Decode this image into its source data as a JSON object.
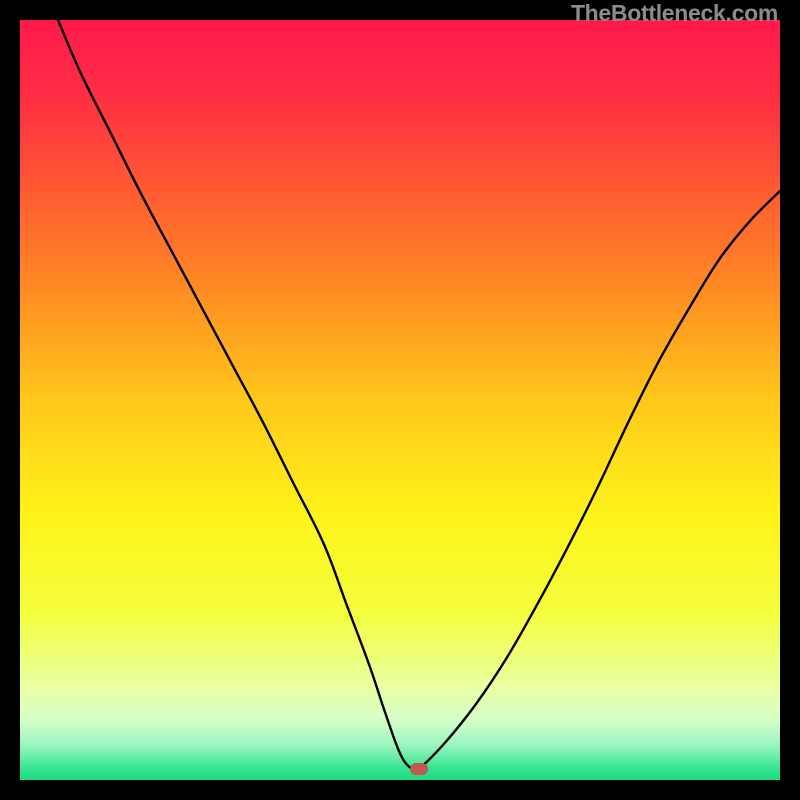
{
  "watermark": "TheBottleneck.com",
  "chart_data": {
    "type": "line",
    "title": "",
    "xlabel": "",
    "ylabel": "",
    "xlim": [
      0,
      100
    ],
    "ylim": [
      0,
      100
    ],
    "grid": false,
    "background_gradient": {
      "stops": [
        {
          "pos": 0.0,
          "color": "#ff1a4d"
        },
        {
          "pos": 0.1,
          "color": "#ff2e44"
        },
        {
          "pos": 0.22,
          "color": "#ff5a33"
        },
        {
          "pos": 0.35,
          "color": "#ff8a24"
        },
        {
          "pos": 0.5,
          "color": "#ffc81a"
        },
        {
          "pos": 0.65,
          "color": "#fff31a"
        },
        {
          "pos": 0.78,
          "color": "#f5ff3d"
        },
        {
          "pos": 0.875,
          "color": "#eaffa0"
        },
        {
          "pos": 0.92,
          "color": "#d8ffc8"
        },
        {
          "pos": 0.955,
          "color": "#98f5c0"
        },
        {
          "pos": 0.985,
          "color": "#34e58e"
        },
        {
          "pos": 1.0,
          "color": "#20d984"
        }
      ]
    },
    "series": [
      {
        "name": "bottleneck-curve",
        "x": [
          5,
          8,
          12,
          16,
          20,
          24,
          28,
          32,
          36,
          40,
          43,
          46,
          48,
          50,
          51.5,
          52.5,
          56,
          60,
          64,
          68,
          72,
          76,
          80,
          84,
          88,
          92,
          96,
          100
        ],
        "values": [
          100,
          93,
          85,
          77,
          69.5,
          62,
          54.5,
          47,
          39,
          31,
          23,
          15,
          9,
          3.5,
          1.5,
          1.5,
          5,
          10,
          16,
          23,
          30.5,
          38.5,
          47,
          55,
          62,
          68.5,
          73.5,
          77.5
        ]
      }
    ],
    "marker": {
      "x": 52.5,
      "y": 1.5,
      "color": "#c1594e"
    }
  }
}
